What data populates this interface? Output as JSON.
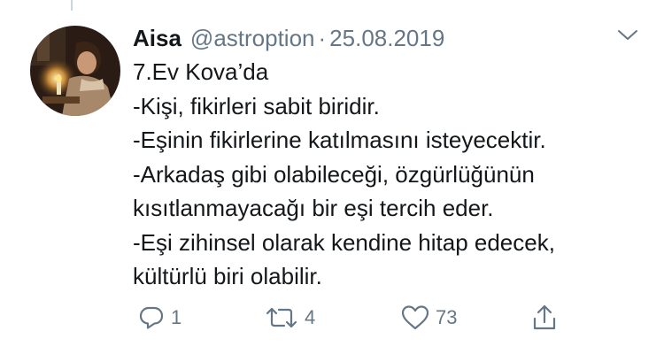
{
  "tweet": {
    "author_name": "Aisa",
    "handle": "@astroption",
    "separator": "·",
    "date": "25.08.2019",
    "lines": [
      "7.Ev Kova’da",
      "-Kişi, fikirleri sabit biridir.",
      "-Eşinin fikirlerine katılmasını isteyecektir.",
      "-Arkadaş gibi olabileceği, özgürlüğünün",
      "kısıtlanmayacağı bir eşi tercih eder.",
      "-Eşi zihinsel olarak kendine hitap edecek,",
      "kültürlü biri olabilir."
    ]
  },
  "actions": {
    "reply": {
      "icon": "reply-icon",
      "count": "1"
    },
    "retweet": {
      "icon": "retweet-icon",
      "count": "4"
    },
    "like": {
      "icon": "heart-icon",
      "count": "73"
    },
    "share": {
      "icon": "share-icon",
      "count": ""
    }
  },
  "colors": {
    "text": "#14171a",
    "secondary": "#657786",
    "thread_line": "#ccd6dd",
    "background": "#ffffff"
  }
}
